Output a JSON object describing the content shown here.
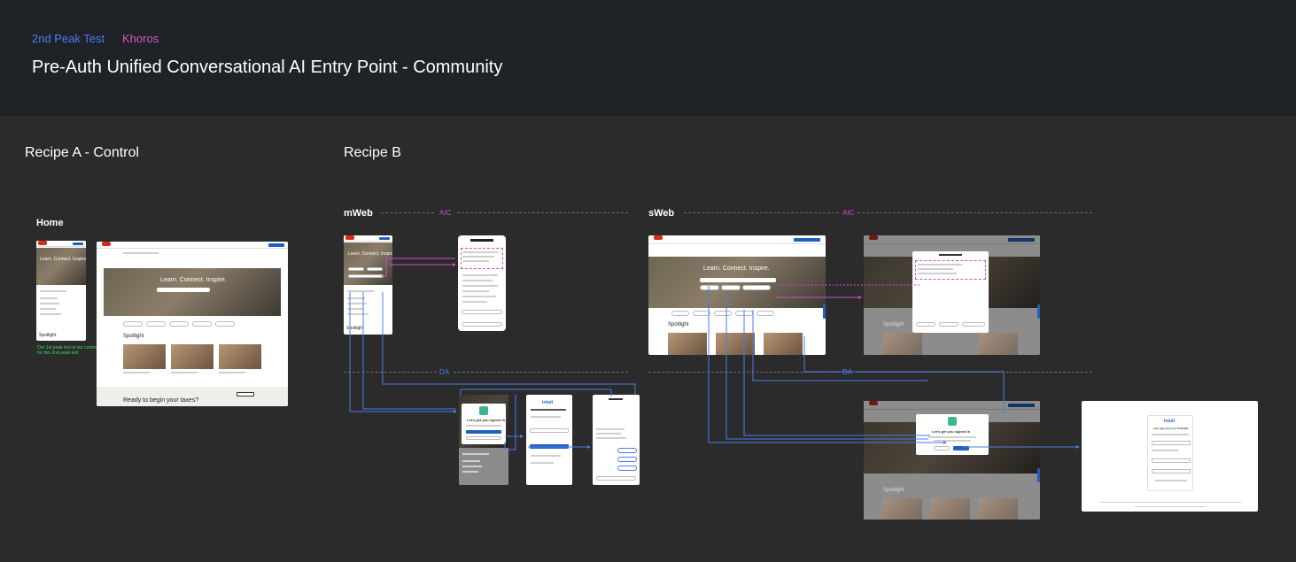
{
  "header": {
    "tag_test": "2nd Peak Test",
    "tag_brand": "Khoros",
    "title": "Pre-Auth Unified Conversational AI Entry Point - Community"
  },
  "sections": {
    "recipe_a": "Recipe A - Control",
    "recipe_b": "Recipe B"
  },
  "labels": {
    "home": "Home",
    "mweb": "mWeb",
    "sweb": "sWeb",
    "aic_mweb": "AIC",
    "aic_sweb": "AIC",
    "da_mweb": "DA",
    "da_sweb": "DA"
  },
  "control_note": "Our 1st peak test is our control for this 2nd peak test",
  "thumbs": {
    "hero_text": "Learn. Connect. Inspire.",
    "spotlight": "Spotlight",
    "ready": "Ready to begin your taxes?",
    "signin": "Let's get you signed in",
    "signin_desktop": "Let's get you in to TurboTax",
    "intuit": "intuit"
  },
  "colors": {
    "aic": "#d14cc6",
    "da": "#4a7de6",
    "header_bg": "#1f2227",
    "canvas_bg": "#2b2b2c"
  }
}
